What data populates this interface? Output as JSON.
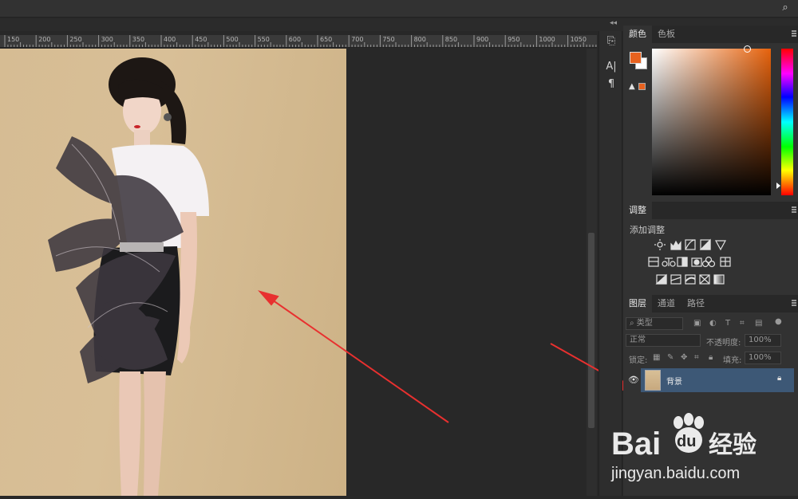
{
  "ruler": {
    "ticks": [
      "150",
      "200",
      "250",
      "300",
      "350",
      "400",
      "450",
      "500",
      "550",
      "600",
      "650",
      "700",
      "750",
      "800",
      "850",
      "900",
      "950",
      "1000",
      "1050"
    ]
  },
  "color_panel": {
    "tabs": [
      "颜色",
      "色板"
    ],
    "foreground": "#e8621f",
    "background": "#ffffff"
  },
  "adjustments_panel": {
    "tab": "调整",
    "title": "添加调整"
  },
  "layers_panel": {
    "tabs": [
      "图层",
      "通道",
      "路径"
    ],
    "filter_kind": "类型",
    "blend_mode": "正常",
    "opacity_label": "不透明度:",
    "opacity_value": "100%",
    "lock_label": "锁定:",
    "fill_label": "填充:",
    "fill_value": "100%",
    "layers": [
      {
        "name": "背景",
        "visible": true,
        "locked": true,
        "selected": true
      }
    ]
  },
  "watermark": {
    "brand_text": "Bai",
    "brand_suffix": "du",
    "brand_cn": "经验",
    "url": "jingyan.baidu.com"
  },
  "colors": {
    "selection_blue": "#3d5876",
    "arrow_red": "#e8302f"
  }
}
